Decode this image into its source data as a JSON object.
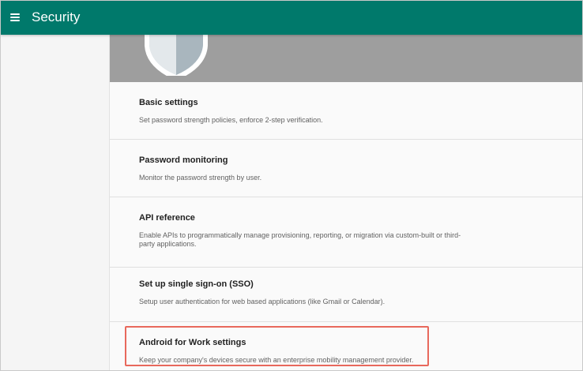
{
  "header": {
    "title": "Security",
    "menu_icon": "hamburger-menu-icon",
    "background_color": "#00796b"
  },
  "banner": {
    "icon": "shield-icon",
    "background_color": "#9e9e9e"
  },
  "cards": [
    {
      "title": "Basic settings",
      "description": "Set password strength policies, enforce 2-step verification."
    },
    {
      "title": "Password monitoring",
      "description": "Monitor the password strength by user."
    },
    {
      "title": "API reference",
      "description": "Enable APIs to programmatically manage provisioning, reporting, or migration via custom-built or third-party applications."
    },
    {
      "title": "Set up single sign-on (SSO)",
      "description": "Setup user authentication for web based applications (like Gmail or Calendar)."
    },
    {
      "title": "Android for Work settings",
      "description": "Keep your company's devices secure with an enterprise mobility management provider."
    }
  ],
  "highlight": {
    "target": "Android for Work settings",
    "color": "#e8685c"
  }
}
